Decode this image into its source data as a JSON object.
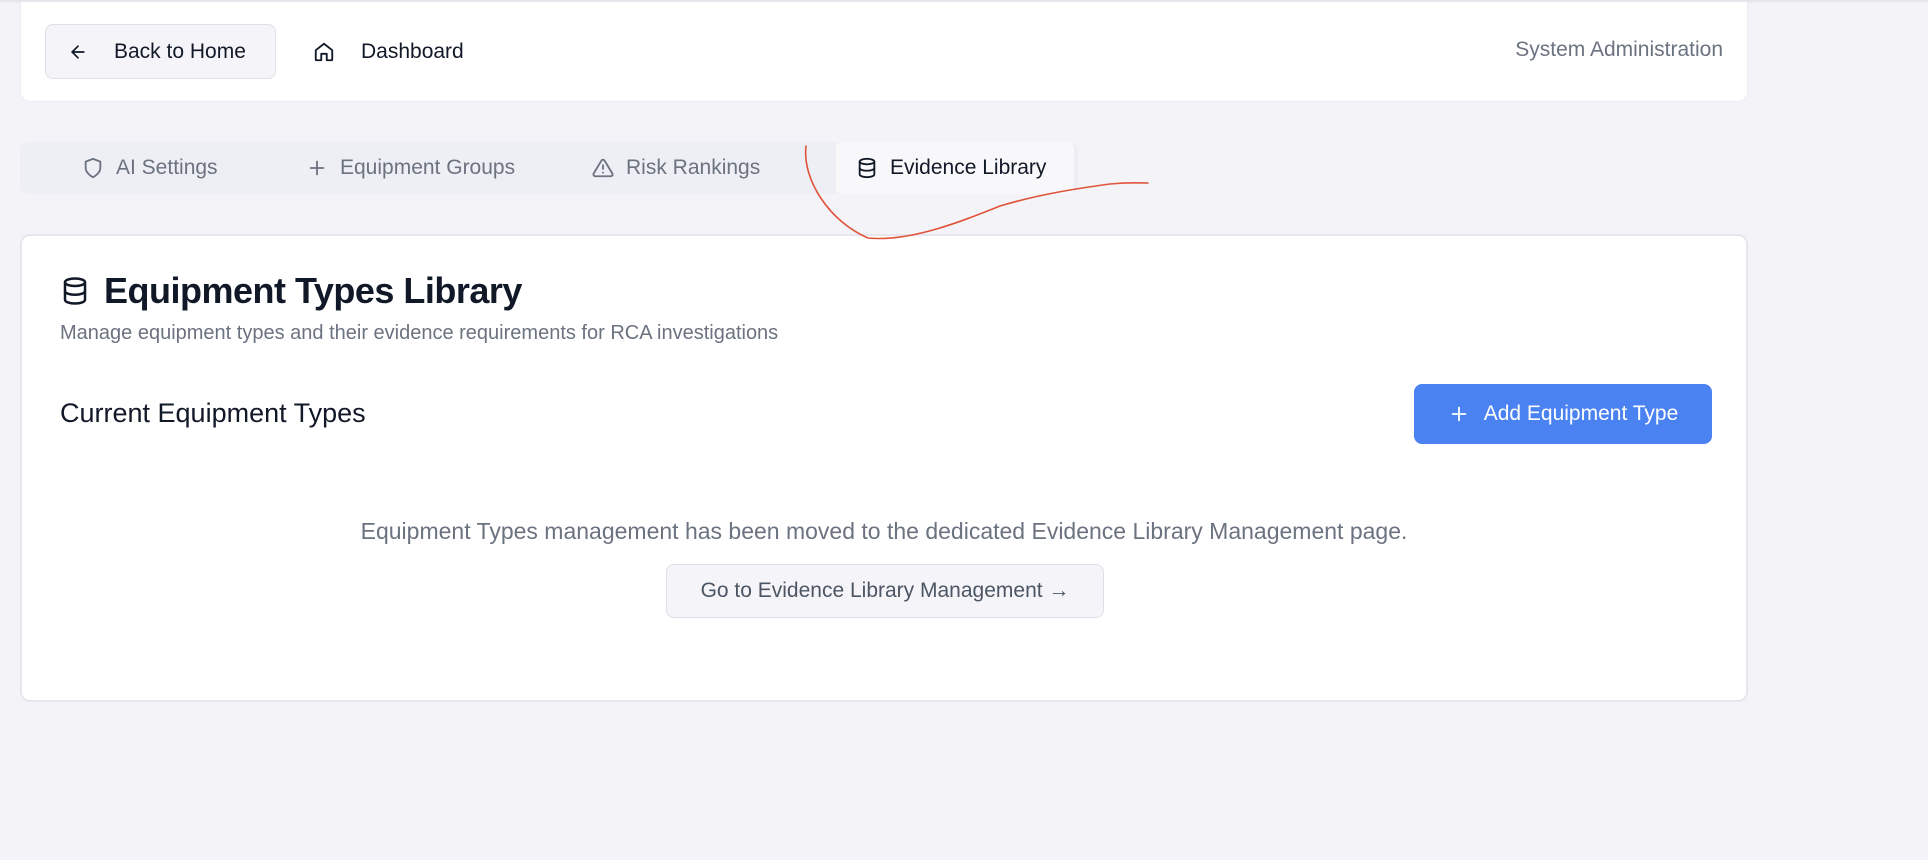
{
  "header": {
    "back_label": "Back to Home",
    "dashboard_label": "Dashboard",
    "section_label": "System Administration"
  },
  "tabs": [
    {
      "label": "AI Settings",
      "icon": "shield-icon",
      "active": false
    },
    {
      "label": "Equipment Groups",
      "icon": "plus-icon",
      "active": false
    },
    {
      "label": "Risk Rankings",
      "icon": "warning-icon",
      "active": false
    },
    {
      "label": "Evidence Library",
      "icon": "database-icon",
      "active": true
    }
  ],
  "card": {
    "title": "Equipment Types Library",
    "description": "Manage equipment types and their evidence requirements for RCA investigations",
    "section_title": "Current Equipment Types",
    "add_button": "Add Equipment Type",
    "moved_message": "Equipment Types management has been moved to the dedicated Evidence Library Management page.",
    "goto_button": "Go to Evidence Library Management →"
  },
  "colors": {
    "page_bg": "#f4f4f8",
    "accent": "#4b82f1",
    "annotation": "#e0533a",
    "muted_text": "#6b7280"
  }
}
